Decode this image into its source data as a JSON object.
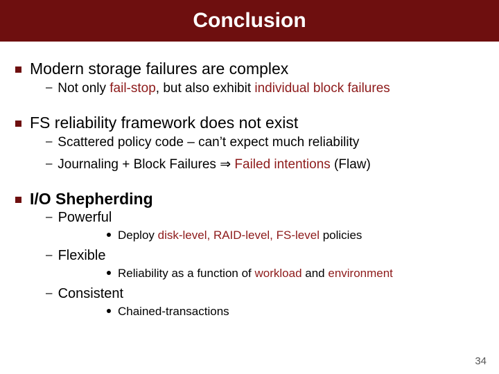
{
  "title": "Conclusion",
  "b1": {
    "head": "Modern storage failures are complex",
    "s1a": "Not only ",
    "s1b": "fail-stop",
    "s1c": ", but also exhibit ",
    "s1d": "individual block failures"
  },
  "b2": {
    "head": "FS reliability framework does not exist",
    "s1": "Scattered policy code – can’t expect much reliability",
    "s2a": "Journaling + Block Failures ",
    "s2arrow": "⇒",
    "s2b": " Failed intentions ",
    "s2c": "(Flaw)"
  },
  "b3": {
    "head": "I/O Shepherding",
    "p1": "Powerful",
    "p1d_a": "Deploy ",
    "p1d_b": "disk-level, RAID-level, FS-level",
    "p1d_c": " policies",
    "p2": "Flexible",
    "p2d_a": "Reliability as a function of ",
    "p2d_b": "workload",
    "p2d_c": " and ",
    "p2d_d": "environment",
    "p3": "Consistent",
    "p3d": "Chained-transactions"
  },
  "page": "34"
}
